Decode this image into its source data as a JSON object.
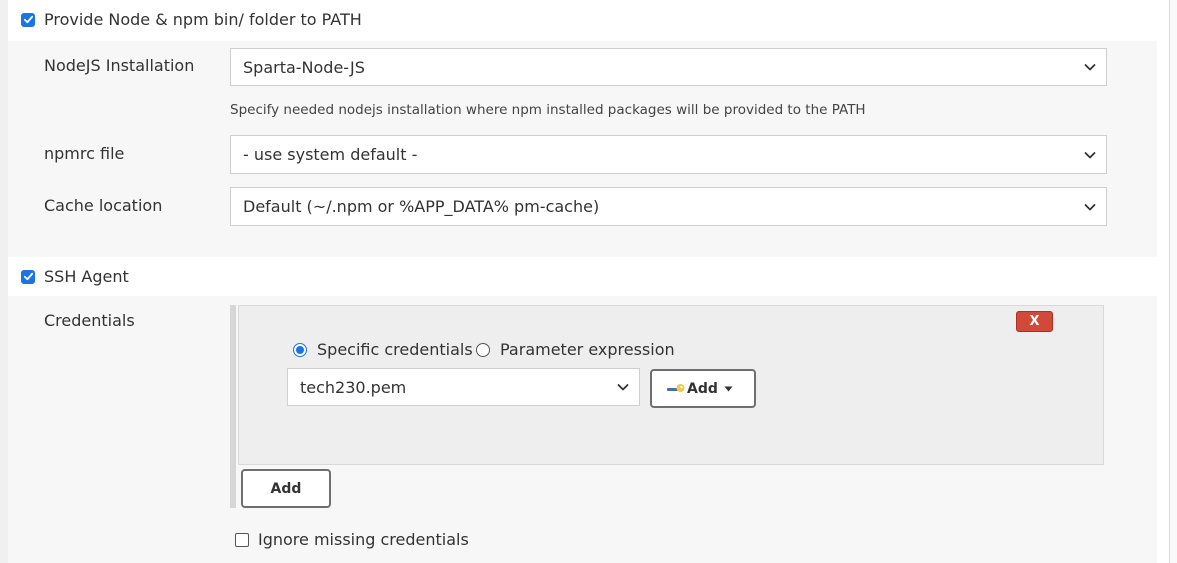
{
  "node_section": {
    "checkbox_label": "Provide Node & npm bin/ folder to PATH",
    "checked": true,
    "nodejs_installation": {
      "label": "NodeJS Installation",
      "value": "Sparta-Node-JS",
      "help": "Specify needed nodejs installation where npm installed packages will be provided to the PATH"
    },
    "npmrc_file": {
      "label": "npmrc file",
      "value": "- use system default -"
    },
    "cache_location": {
      "label": "Cache location",
      "value": "Default (~/.npm or %APP_DATA% pm-cache)"
    }
  },
  "ssh_section": {
    "checkbox_label": "SSH Agent",
    "checked": true,
    "credentials_label": "Credentials",
    "delete_label": "X",
    "radio_specific": "Specific credentials",
    "radio_parameter": "Parameter expression",
    "selected_radio": "specific",
    "credential_value": "tech230.pem",
    "add_key_label": "Add",
    "add_label": "Add",
    "ignore_missing_label": "Ignore missing credentials",
    "ignore_missing_checked": false
  },
  "colors": {
    "accent": "#1a73e8",
    "delete": "#d24939",
    "panel": "#f7f7f7"
  },
  "icons": {
    "checkbox": "check-icon",
    "select": "chevron-down-icon",
    "add_key": "key-icon",
    "dropdown_caret": "caret-down-icon"
  }
}
